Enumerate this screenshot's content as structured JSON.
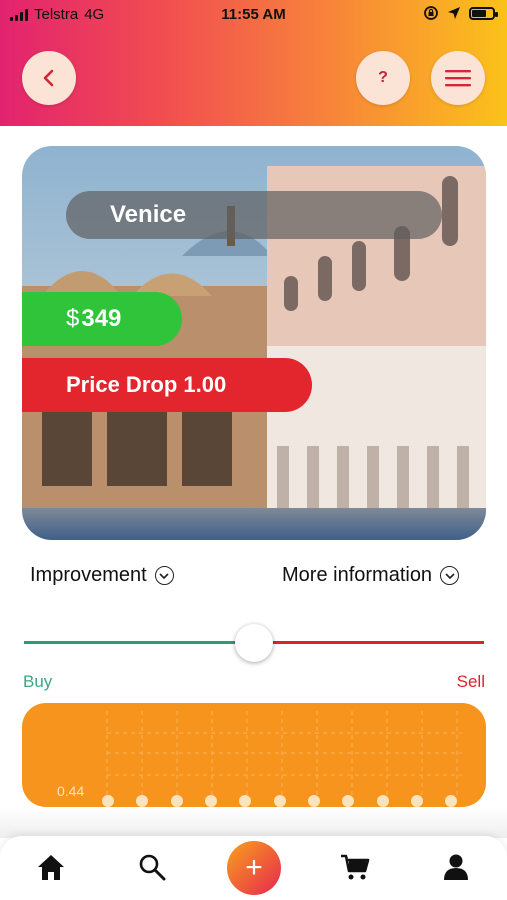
{
  "status_bar": {
    "carrier": "Telstra",
    "network": "4G",
    "time": "11:55 AM"
  },
  "header": {
    "help_label": "?"
  },
  "hero": {
    "city": "Venice",
    "currency": "$",
    "price": "349",
    "price_drop": "Price Drop 1.00"
  },
  "info": {
    "improvement": "Improvement",
    "more_information": "More information"
  },
  "slider": {
    "buy_label": "Buy",
    "sell_label": "Sell",
    "position": 0.5,
    "buy_color": "#2e9a76",
    "sell_color": "#d8252c"
  },
  "panel": {
    "value": "0.44",
    "color": "#f7941d"
  },
  "bottom_nav": {
    "items": [
      "home-icon",
      "search-icon",
      "add-icon",
      "cart-icon",
      "profile-icon"
    ],
    "add_label": "+"
  },
  "colors": {
    "gradient_start": "#e2236f",
    "gradient_end": "#fbc21a",
    "price_green": "#2fc43a",
    "drop_red": "#e3262d"
  }
}
